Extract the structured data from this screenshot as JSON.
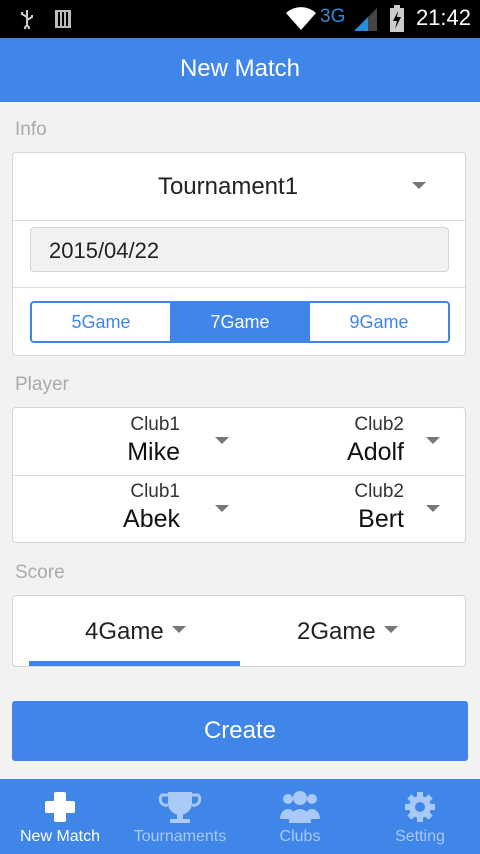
{
  "status_bar": {
    "time": "21:42",
    "network": "3G"
  },
  "app_bar": {
    "title": "New Match"
  },
  "info": {
    "label": "Info",
    "tournament": "Tournament1",
    "date": "2015/04/22",
    "game_options": [
      "5Game",
      "7Game",
      "9Game"
    ],
    "selected_game": "7Game"
  },
  "player": {
    "label": "Player",
    "rows": [
      {
        "left": {
          "club": "Club1",
          "name": "Mike"
        },
        "right": {
          "club": "Club2",
          "name": "Adolf"
        }
      },
      {
        "left": {
          "club": "Club1",
          "name": "Abek"
        },
        "right": {
          "club": "Club2",
          "name": "Bert"
        }
      }
    ]
  },
  "score": {
    "label": "Score",
    "left": "4Game",
    "right": "2Game"
  },
  "create_button": {
    "label": "Create"
  },
  "bottom_nav": {
    "items": [
      {
        "label": "New Match",
        "icon": "plus-icon",
        "active": true
      },
      {
        "label": "Tournaments",
        "icon": "trophy-icon",
        "active": false
      },
      {
        "label": "Clubs",
        "icon": "people-icon",
        "active": false
      },
      {
        "label": "Setting",
        "icon": "gear-icon",
        "active": false
      }
    ]
  },
  "colors": {
    "accent": "#3f86e8",
    "background": "#f2f2f2"
  }
}
